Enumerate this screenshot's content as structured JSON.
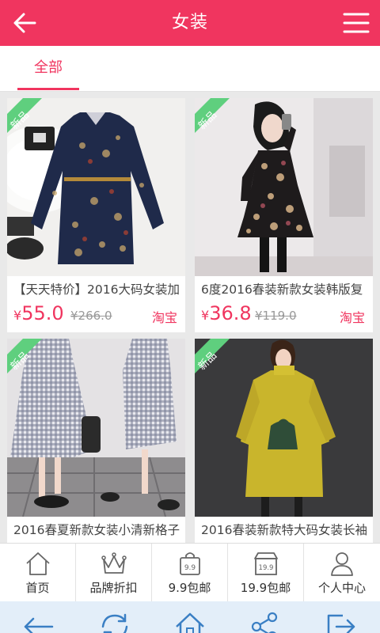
{
  "header": {
    "title": "女装",
    "back_icon": "arrow-left-icon",
    "menu_icon": "hamburger-menu-icon"
  },
  "tabs": [
    {
      "label": "全部",
      "active": true
    }
  ],
  "products": [
    {
      "name": "【天天特价】2016大码女装加",
      "currency": "¥",
      "price": "55.0",
      "old_price": "¥266.0",
      "source": "淘宝",
      "badge": "新品"
    },
    {
      "name": "6度2016春装新款女装韩版复",
      "currency": "¥",
      "price": "36.8",
      "old_price": "¥119.0",
      "source": "淘宝",
      "badge": "新品"
    },
    {
      "name": "2016春夏新款女装小清新格子",
      "badge": "新品"
    },
    {
      "name": "2016春装新款特大码女装长袖",
      "badge": "新品"
    }
  ],
  "bottom_nav": [
    {
      "label": "首页",
      "icon": "home-icon"
    },
    {
      "label": "品牌折扣",
      "icon": "crown-icon"
    },
    {
      "label": "9.9包邮",
      "icon": "bag-9-9-icon"
    },
    {
      "label": "19.9包邮",
      "icon": "shop-19-9-icon"
    },
    {
      "label": "个人中心",
      "icon": "user-icon"
    }
  ],
  "icon_text": {
    "nine": "9.9",
    "nineteen": "19.9"
  },
  "colors": {
    "accent": "#f0355f",
    "badge": "#5fcf7e",
    "nav_icon": "#666666",
    "sys_icon": "#3a7fc4"
  }
}
